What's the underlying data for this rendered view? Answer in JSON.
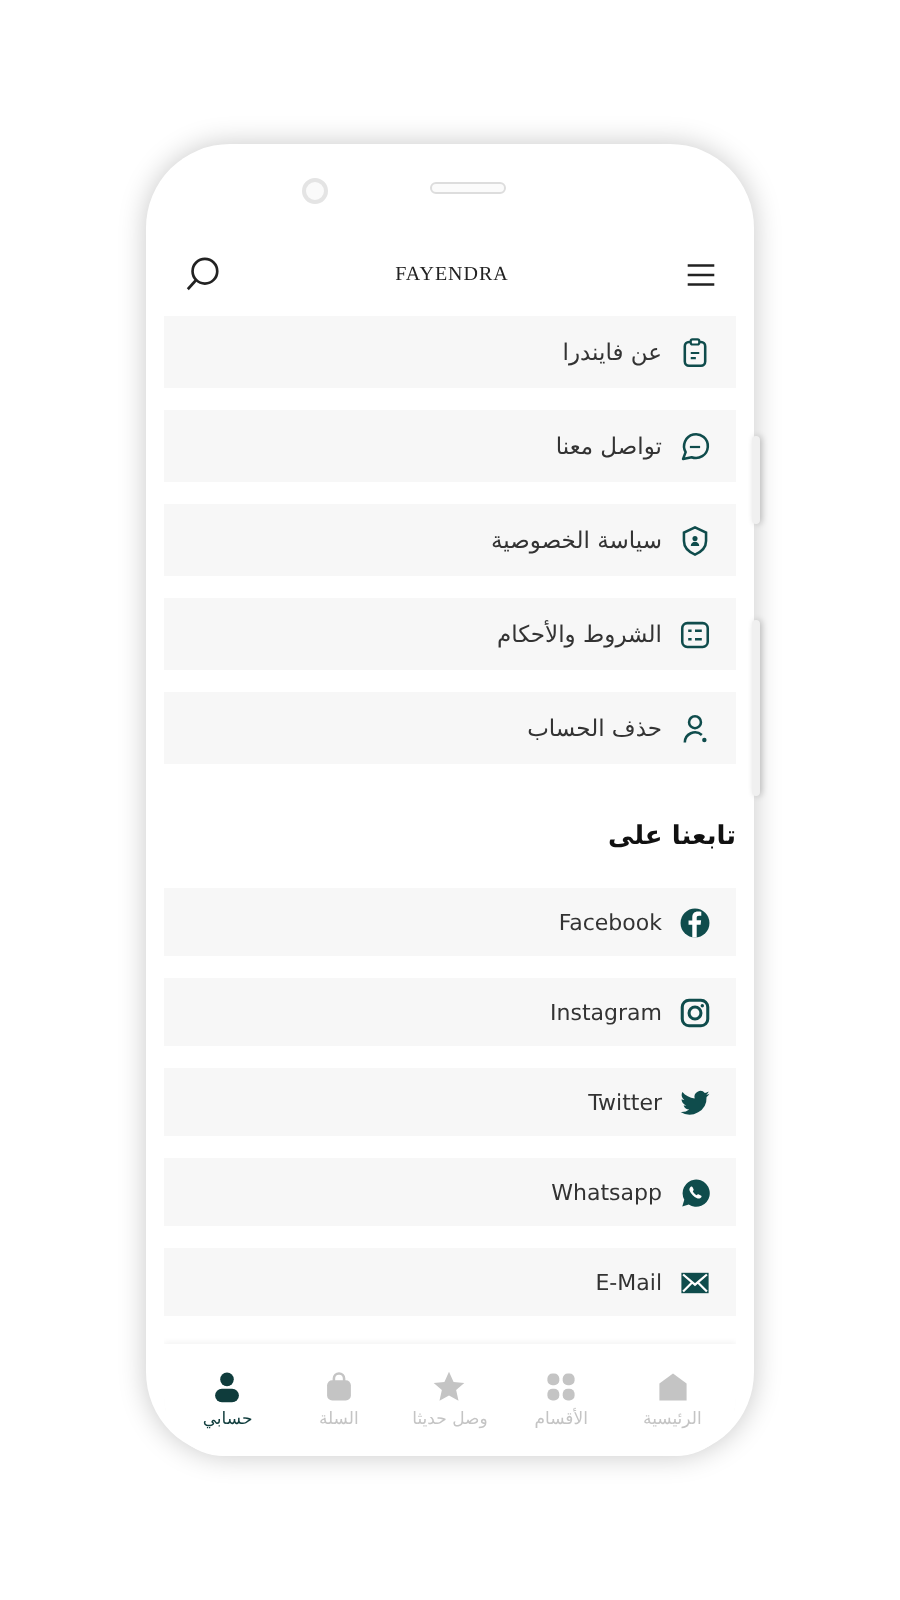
{
  "header": {
    "title": "FAYENDRA"
  },
  "menu": [
    "عن فايندرا",
    "تواصل معنا",
    "سياسة الخصوصية",
    "الشروط والأحكام",
    "حذف الحساب"
  ],
  "follow": {
    "heading": "تابعنا على",
    "links": [
      "Facebook",
      "Instagram",
      "Twitter",
      "Whatsapp",
      "E-Mail"
    ]
  },
  "nav": [
    {
      "label": "الرئيسية",
      "selected": false
    },
    {
      "label": "الأقسام",
      "selected": false
    },
    {
      "label": "وصل حديثا",
      "selected": false
    },
    {
      "label": "السلة",
      "selected": false
    },
    {
      "label": "حسابي",
      "selected": true
    }
  ]
}
